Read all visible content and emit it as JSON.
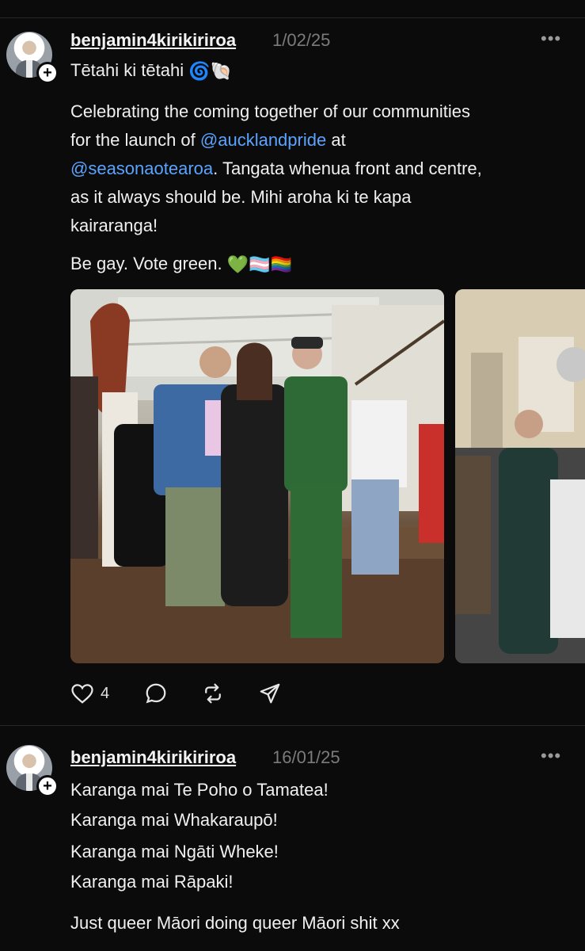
{
  "posts": [
    {
      "username": "benjamin4kirikiriroa",
      "date": "1/02/25",
      "more": "•••",
      "title": "Tētahi ki tētahi",
      "title_emoji": "🌀🐚",
      "body_l1": "Celebrating the coming together of our communities",
      "body_l2_pre": "for the launch of ",
      "mention1": "@aucklandpride",
      "body_l2_post": " at",
      "mention2": "@seasonaotearoa",
      "body_l3_post": ". Tangata whenua front and centre,",
      "body_l4": "as it always should be. Mihi aroha ki te kapa",
      "body_l5": "kairaranga!",
      "tagline": "Be gay. Vote green.",
      "tagline_emoji": "💚🏳️‍⚧️🏳️‍🌈",
      "likes": "4"
    },
    {
      "username": "benjamin4kirikiriroa",
      "date": "16/01/25",
      "more": "•••",
      "l1": "Karanga mai Te Poho o Tamatea!",
      "l2": "Karanga mai Whakaraupō!",
      "l3": "Karanga mai Ngāti Wheke!",
      "l4": "Karanga mai Rāpaki!",
      "l5": "Just queer Māori doing queer Māori shit xx"
    }
  ],
  "icons": {
    "like": "heart-icon",
    "reply": "comment-icon",
    "repost": "repost-icon",
    "share": "send-icon",
    "follow": "plus-icon",
    "menu": "more-icon"
  },
  "colors": {
    "background": "#0b0b0b",
    "mention": "#5aa4ff",
    "date": "#7b7b7b"
  }
}
